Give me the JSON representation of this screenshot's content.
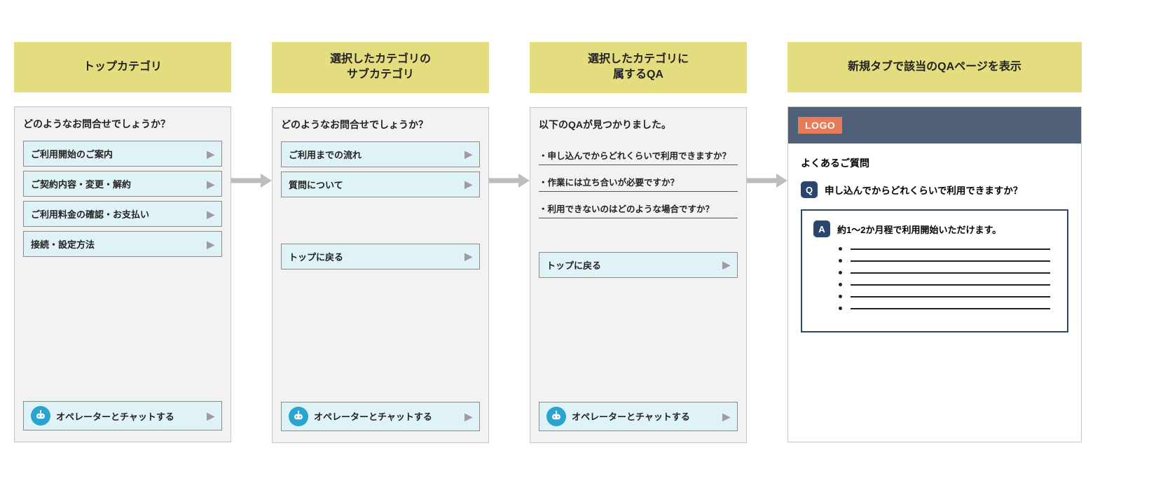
{
  "headers": {
    "top_category": "トップカテゴリ",
    "sub_category": "選択したカテゴリの\nサブカテゴリ",
    "qa_list": "選択したカテゴリに\n属するQA",
    "qa_page": "新規タブで該当のQAページを表示"
  },
  "panel1": {
    "prompt": "どのようなお問合せでしょうか？",
    "options": [
      "ご利用開始のご案内",
      "ご契約内容・変更・解約",
      "ご利用料金の確認・お支払い",
      "接続・設定方法"
    ],
    "operator_label": "オペレーターとチャットする"
  },
  "panel2": {
    "prompt": "どのようなお問合せでしょうか？",
    "options": [
      "ご利用までの流れ",
      "質問について"
    ],
    "back_label": "トップに戻る",
    "operator_label": "オペレーターとチャットする"
  },
  "panel3": {
    "prompt": "以下のQAが見つかりました。",
    "qas": [
      "申し込んでからどれくらいで利用できますか？",
      "作業には立ち合いが必要ですか？",
      "利用できないのはどのような場合ですか？"
    ],
    "back_label": "トップに戻る",
    "operator_label": "オペレーターとチャットする"
  },
  "qa_page": {
    "logo": "LOGO",
    "faq_heading": "よくあるご質問",
    "q_badge": "Q",
    "a_badge": "A",
    "question": "申し込んでからどれくらいで利用できますか？",
    "answer": "約1〜2か月程で利用開始いただけます。",
    "bullet_count": 6
  }
}
